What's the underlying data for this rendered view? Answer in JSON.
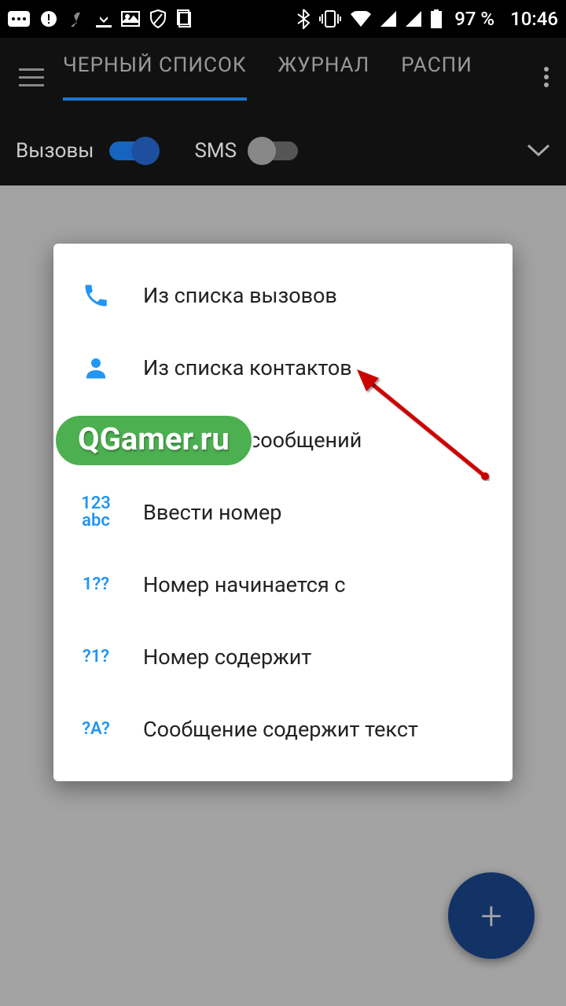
{
  "statusbar": {
    "battery": "97 %",
    "clock": "10:46"
  },
  "tabs": [
    "ЧЕРНЫЙ СПИСОК",
    "ЖУРНАЛ",
    "РАСПИ"
  ],
  "active_tab": 0,
  "toggles": {
    "calls_label": "Вызовы",
    "sms_label": "SMS"
  },
  "dialog": {
    "items": [
      {
        "icon": "phone-icon",
        "label": "Из списка вызовов"
      },
      {
        "icon": "person-icon",
        "label": "Из списка контактов"
      },
      {
        "icon": "message-icon",
        "label": "Из списка сообщений"
      },
      {
        "icon": "123-abc",
        "label": "Ввести номер"
      },
      {
        "icon": "1??",
        "label": "Номер начинается с"
      },
      {
        "icon": "?1?",
        "label": "Номер содержит"
      },
      {
        "icon": "?A?",
        "label": "Сообщение содержит текст"
      }
    ]
  },
  "fab_icon": "+",
  "watermark": "QGamer.ru"
}
